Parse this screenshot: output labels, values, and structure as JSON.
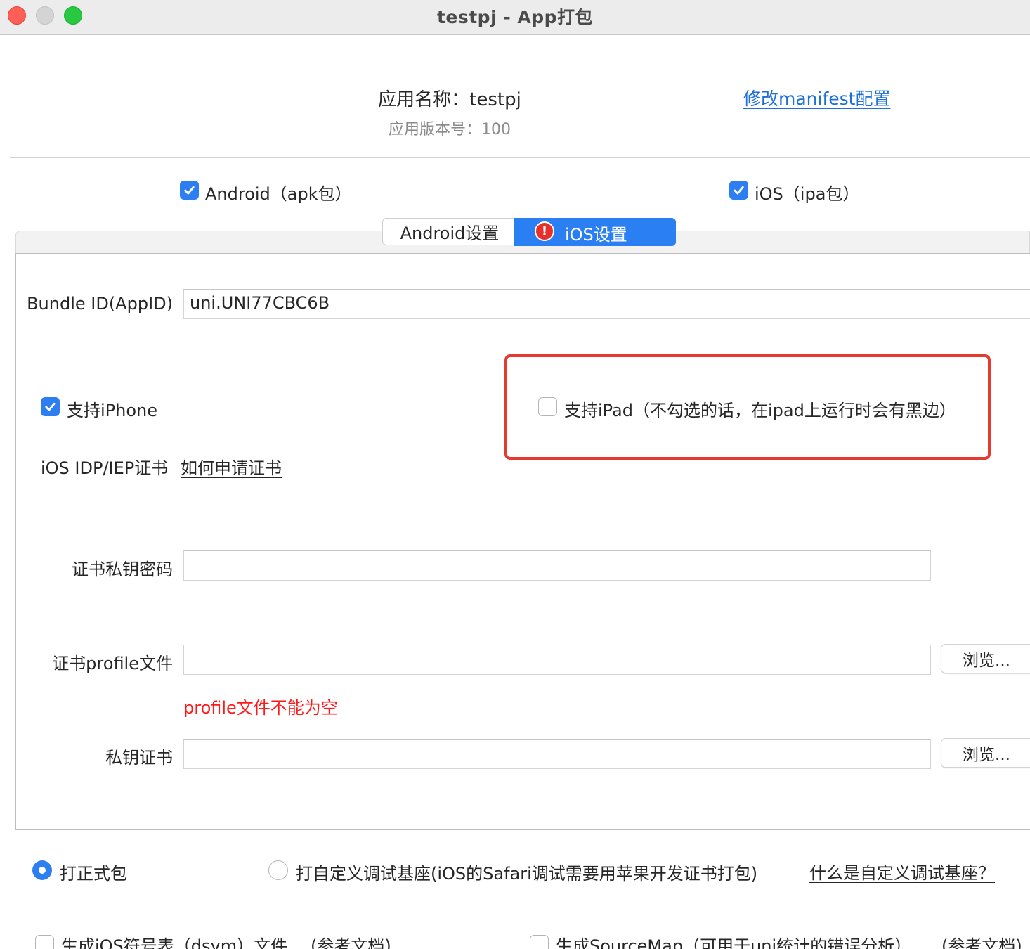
{
  "window": {
    "title": "testpj - App打包"
  },
  "header": {
    "app_name": "应用名称：testpj",
    "app_version": "应用版本号：100",
    "manifest_link": "修改manifest配置"
  },
  "platforms": [
    {
      "label": "Android（apk包）",
      "checked": true
    },
    {
      "label": "iOS（ipa包）",
      "checked": true
    }
  ],
  "tabs": [
    {
      "label": "Android设置",
      "active": false
    },
    {
      "label": "iOS设置",
      "active": true,
      "error": "!"
    }
  ],
  "ios": {
    "bundle_label": "Bundle ID(AppID)",
    "bundle_value": "uni.UNI77CBC6B",
    "iphone_label": "支持iPhone",
    "iphone_checked": true,
    "ipad_label": "支持iPad（不勾选的话，在ipad上运行时会有黑边）",
    "ipad_checked": false,
    "cert_label": "iOS IDP/IEP证书",
    "cert_link": "如何申请证书",
    "password_label": "证书私钥密码",
    "password_value": "",
    "profile_label": "证书profile文件",
    "profile_value": "",
    "browse_label": "浏览...",
    "profile_error": "profile文件不能为空",
    "key_label": "私钥证书",
    "key_value": ""
  },
  "build": {
    "options": [
      {
        "label": "打正式包",
        "selected": true
      },
      {
        "label": "打自定义调试基座(iOS的Safari调试需要用苹果开发证书打包)",
        "selected": false
      }
    ],
    "help_link": "什么是自定义调试基座？"
  },
  "extras": [
    {
      "label": "生成iOS符号表（dsym）文件",
      "link": "(参考文档)",
      "checked": false
    },
    {
      "label": "生成SourceMap（可用于uni统计的错误分析）",
      "link": "(参考文档)",
      "checked": false
    }
  ],
  "colors": {
    "accent": "#2d7ff1",
    "link": "#1e6fd9",
    "error": "#ff1a1a",
    "highlight_box": "#e53a30"
  }
}
